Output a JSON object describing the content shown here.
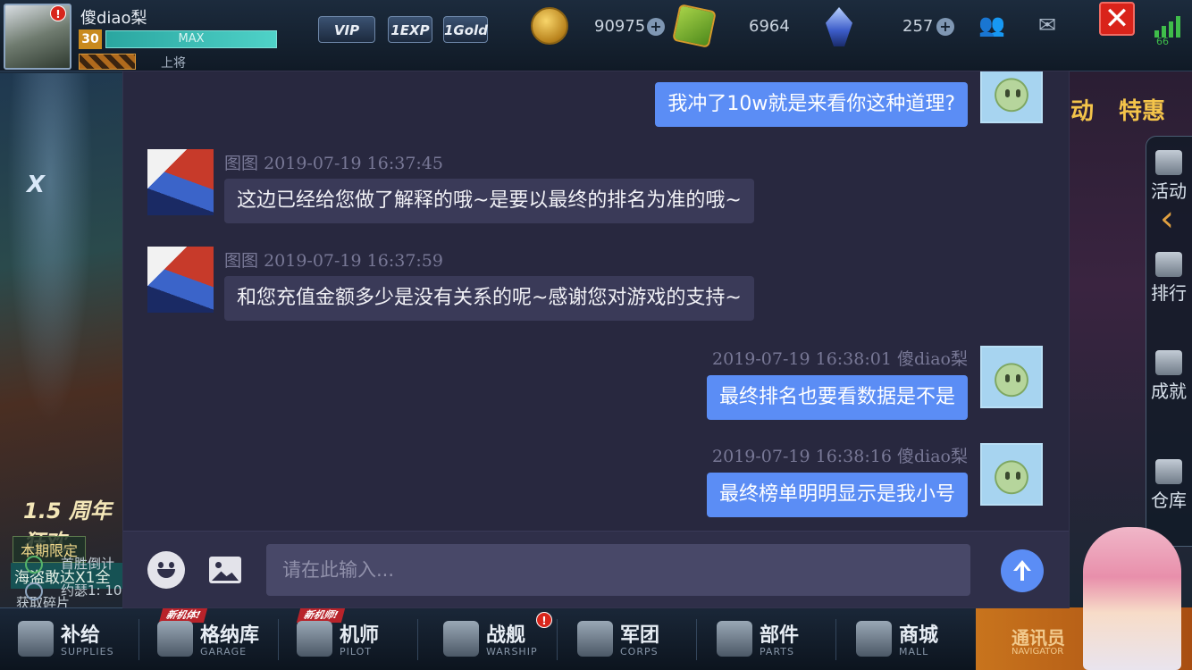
{
  "player": {
    "name": "傻diao梨",
    "level": "30",
    "xp_label": "MAX",
    "rank": "上将"
  },
  "badges": {
    "vip": "VIP",
    "exp": "1EXP",
    "gold": "1Gold"
  },
  "currencies": {
    "gold": "90975",
    "cube": "6964",
    "crystal": "257"
  },
  "signal": {
    "value": "66"
  },
  "left_banner": {
    "logo": "X",
    "anniversary": "1.5 周年狂欢",
    "limited_tag": "本期限定",
    "pirate": "海盗敢达X1全",
    "fragment": "获取碎片",
    "row1": "首胜倒计",
    "row2": "约瑟1: 10"
  },
  "right_panel": {
    "event_left": "动",
    "event_right": "特惠",
    "tabs": [
      "活动",
      "排行",
      "成就",
      "仓库"
    ]
  },
  "chat": {
    "messages": [
      {
        "side": "out",
        "text": "我冲了10w就是来看你这种道理?"
      },
      {
        "side": "in",
        "sender": "图图",
        "time": "2019-07-19 16:37:45",
        "text": "这边已经给您做了解释的哦~是要以最终的排名为准的哦~"
      },
      {
        "side": "in",
        "sender": "图图",
        "time": "2019-07-19 16:37:59",
        "text": "和您充值金额多少是没有关系的呢~感谢您对游戏的支持~"
      },
      {
        "side": "out",
        "sender": "傻diao梨",
        "time": "2019-07-19 16:38:01",
        "text": "最终排名也要看数据是不是"
      },
      {
        "side": "out",
        "sender": "傻diao梨",
        "time": "2019-07-19 16:38:16",
        "text": "最终榜单明明显示是我小号"
      }
    ],
    "input_placeholder": "请在此输入..."
  },
  "bottom_nav": [
    {
      "zh": "补给",
      "en": "SUPPLIES"
    },
    {
      "zh": "格纳库",
      "en": "GARAGE",
      "tag": "新机体!"
    },
    {
      "zh": "机师",
      "en": "PILOT",
      "tag": "新机师!"
    },
    {
      "zh": "战舰",
      "en": "WARSHIP"
    },
    {
      "zh": "军团",
      "en": "CORPS"
    },
    {
      "zh": "部件",
      "en": "PARTS"
    },
    {
      "zh": "商城",
      "en": "MALL"
    }
  ],
  "navigator": {
    "zh": "通讯员",
    "en": "NAVIGATOR"
  },
  "colors": {
    "accent": "#5b8df5",
    "modal_bg": "#28283f",
    "alert": "#d9231a"
  }
}
